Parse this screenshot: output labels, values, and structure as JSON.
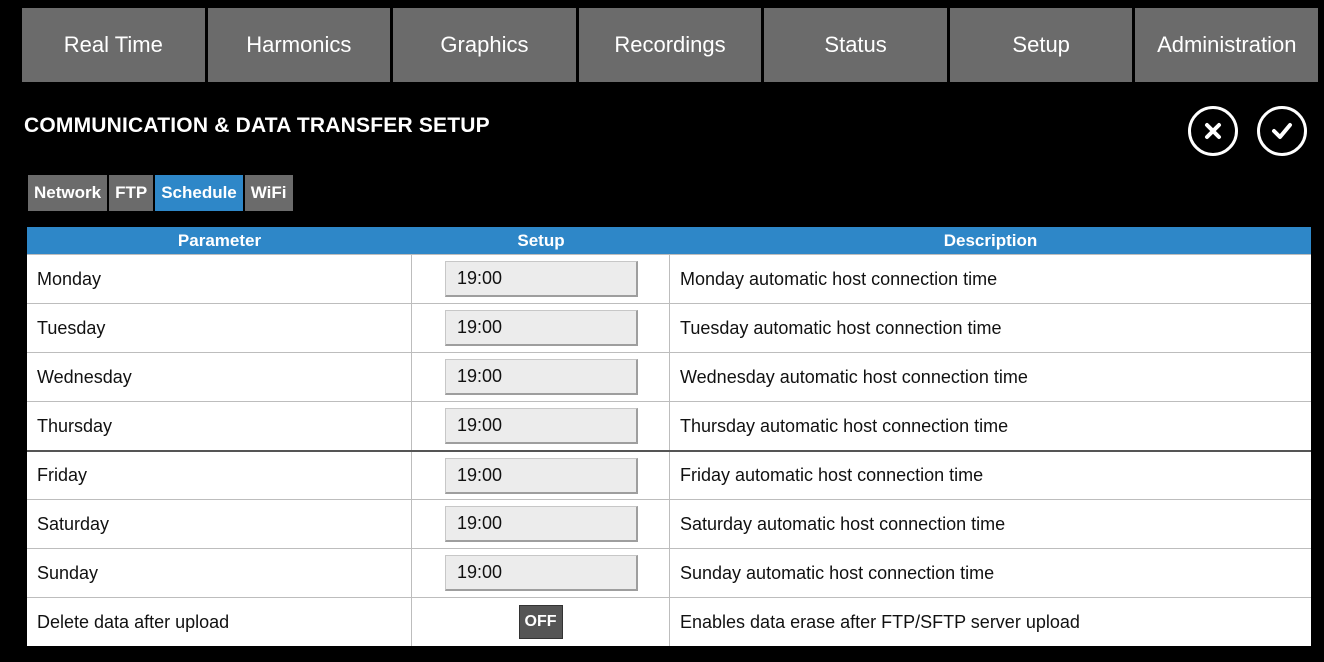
{
  "nav": {
    "tabs": [
      "Real Time",
      "Harmonics",
      "Graphics",
      "Recordings",
      "Status",
      "Setup",
      "Administration"
    ]
  },
  "header": {
    "title": "COMMUNICATION & DATA TRANSFER SETUP"
  },
  "subtabs": {
    "items": [
      "Network",
      "FTP",
      "Schedule",
      "WiFi"
    ],
    "active": "Schedule"
  },
  "table": {
    "columns": [
      "Parameter",
      "Setup",
      "Description"
    ],
    "rows": [
      {
        "param": "Monday",
        "value": "19:00",
        "desc": "Monday automatic host connection time"
      },
      {
        "param": "Tuesday",
        "value": "19:00",
        "desc": "Tuesday automatic host connection time"
      },
      {
        "param": "Wednesday",
        "value": "19:00",
        "desc": "Wednesday automatic host connection time"
      },
      {
        "param": "Thursday",
        "value": "19:00",
        "desc": "Thursday automatic host connection time"
      },
      {
        "param": "Friday",
        "value": "19:00",
        "desc": "Friday automatic host connection time"
      },
      {
        "param": "Saturday",
        "value": "19:00",
        "desc": "Saturday automatic host connection time"
      },
      {
        "param": "Sunday",
        "value": "19:00",
        "desc": "Sunday automatic host connection time"
      },
      {
        "param": "Delete data after upload",
        "toggle": "OFF",
        "desc": "Enables data erase after FTP/SFTP server upload"
      }
    ]
  },
  "colors": {
    "accent": "#2e87c8",
    "tab_bg": "#6b6b6b",
    "background": "#000000"
  }
}
